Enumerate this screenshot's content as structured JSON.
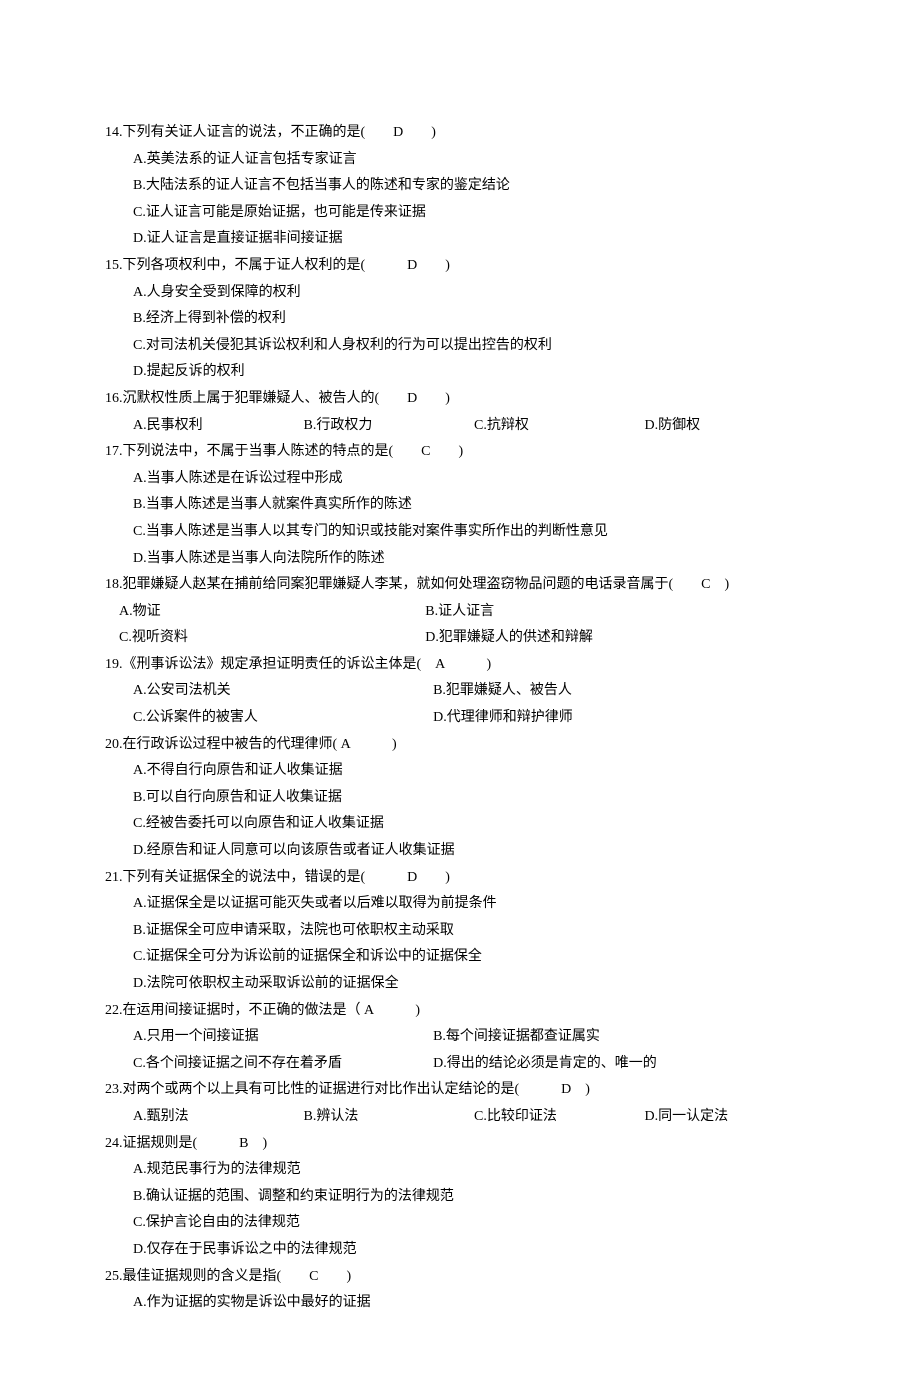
{
  "q14": {
    "stem": "14.下列有关证人证言的说法，不正确的是(　　D　　)",
    "a": "A.英美法系的证人证言包括专家证言",
    "b": "B.大陆法系的证人证言不包括当事人的陈述和专家的鉴定结论",
    "c": "C.证人证言可能是原始证据，也可能是传来证据",
    "d": "D.证人证言是直接证据非间接证据"
  },
  "q15": {
    "stem": "15.下列各项权利中，不属于证人权利的是(　　　D　　)",
    "a": "A.人身安全受到保障的权利",
    "b": "B.经济上得到补偿的权利",
    "c": "C.对司法机关侵犯其诉讼权利和人身权利的行为可以提出控告的权利",
    "d": "D.提起反诉的权利"
  },
  "q16": {
    "stem": "16.沉默权性质上属于犯罪嫌疑人、被告人的(　　D　　)",
    "a": "A.民事权利",
    "b": "B.行政权力",
    "c": "C.抗辩权",
    "d": "D.防御权"
  },
  "q17": {
    "stem": "17.下列说法中，不属于当事人陈述的特点的是(　　C　　)",
    "a": "A.当事人陈述是在诉讼过程中形成",
    "b": "B.当事人陈述是当事人就案件真实所作的陈述",
    "c": "C.当事人陈述是当事人以其专门的知识或技能对案件事实所作出的判断性意见",
    "d": "D.当事人陈述是当事人向法院所作的陈述"
  },
  "q18": {
    "stem": "18.犯罪嫌疑人赵某在捕前给同案犯罪嫌疑人李某，就如何处理盗窃物品问题的电话录音属于(　　C　)",
    "a": "A.物证",
    "b": "B.证人证言",
    "c": "C.视听资料",
    "d": "D.犯罪嫌疑人的供述和辩解"
  },
  "q19": {
    "stem": "19.《刑事诉讼法》规定承担证明责任的诉讼主体是(　A　　　)",
    "a": "A.公安司法机关",
    "b": "B.犯罪嫌疑人、被告人",
    "c": "C.公诉案件的被害人",
    "d": "D.代理律师和辩护律师"
  },
  "q20": {
    "stem": "20.在行政诉讼过程中被告的代理律师( A　　　)",
    "a": "A.不得自行向原告和证人收集证据",
    "b": "B.可以自行向原告和证人收集证据",
    "c": "C.经被告委托可以向原告和证人收集证据",
    "d": "D.经原告和证人同意可以向该原告或者证人收集证据"
  },
  "q21": {
    "stem": "21.下列有关证据保全的说法中，错误的是(　　　D　　)",
    "a": "A.证据保全是以证据可能灭失或者以后难以取得为前提条件",
    "b": "B.证据保全可应申请采取，法院也可依职权主动采取",
    "c": "C.证据保全可分为诉讼前的证据保全和诉讼中的证据保全",
    "d": "D.法院可依职权主动采取诉讼前的证据保全"
  },
  "q22": {
    "stem": "22.在运用间接证据时，不正确的做法是（ A　　　)",
    "a": "A.只用一个间接证据",
    "b": "B.每个间接证据都查证属实",
    "c": "C.各个间接证据之间不存在着矛盾",
    "d": "D.得出的结论必须是肯定的、唯一的"
  },
  "q23": {
    "stem": "23.对两个或两个以上具有可比性的证据进行对比作出认定结论的是(　　　D　)",
    "a": "A.甄别法",
    "b": "B.辨认法",
    "c": "C.比较印证法",
    "d": "D.同一认定法"
  },
  "q24": {
    "stem": "24.证据规则是(　　　B　)",
    "a": "A.规范民事行为的法律规范",
    "b": "B.确认证据的范围、调整和约束证明行为的法律规范",
    "c": "C.保护言论自由的法律规范",
    "d": "D.仅存在于民事诉讼之中的法律规范"
  },
  "q25": {
    "stem": "25.最佳证据规则的含义是指(　　C　　)",
    "a": "A.作为证据的实物是诉讼中最好的证据"
  }
}
